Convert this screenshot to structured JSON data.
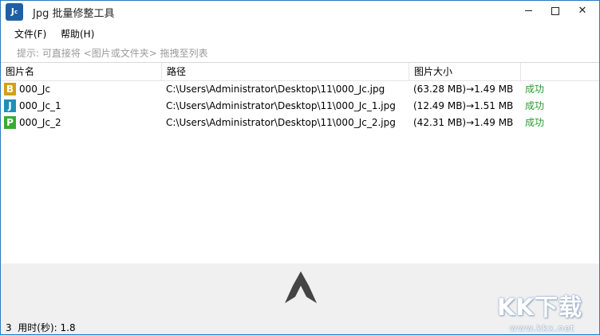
{
  "app": {
    "title": "Jpg 批量修整工具",
    "icon_text": "J",
    "icon_sub": "c"
  },
  "menu": {
    "file_label": "文件(F)",
    "help_label": "帮助(H)"
  },
  "hint": "提示: 可直接将 <图片或文件夹> 拖拽至列表",
  "table": {
    "headers": [
      "图片名",
      "路径",
      "图片大小",
      ""
    ],
    "rows": [
      {
        "badge": "B",
        "badge_color": "#d4a017",
        "name": "000_Jc",
        "path": "C:\\Users\\Administrator\\Desktop\\11\\000_Jc.jpg",
        "size": "(63.28 MB)→1.49 MB",
        "status": "成功"
      },
      {
        "badge": "J",
        "badge_color": "#1f8fb8",
        "name": "000_Jc_1",
        "path": "C:\\Users\\Administrator\\Desktop\\11\\000_Jc_1.jpg",
        "size": "(12.49 MB)→1.51 MB",
        "status": "成功"
      },
      {
        "badge": "P",
        "badge_color": "#3aaa35",
        "name": "000_Jc_2",
        "path": "C:\\Users\\Administrator\\Desktop\\11\\000_Jc_2.jpg",
        "size": "(42.31 MB)→1.49 MB",
        "status": "成功"
      }
    ]
  },
  "status": {
    "count": "3",
    "time_label": "用时(秒): 1.8"
  },
  "watermark": {
    "text": "KK下载",
    "url": "www.kkx.net"
  },
  "colors": {
    "accent": "#2b79c2",
    "success": "#2a9a2a",
    "logo": "#444444"
  }
}
